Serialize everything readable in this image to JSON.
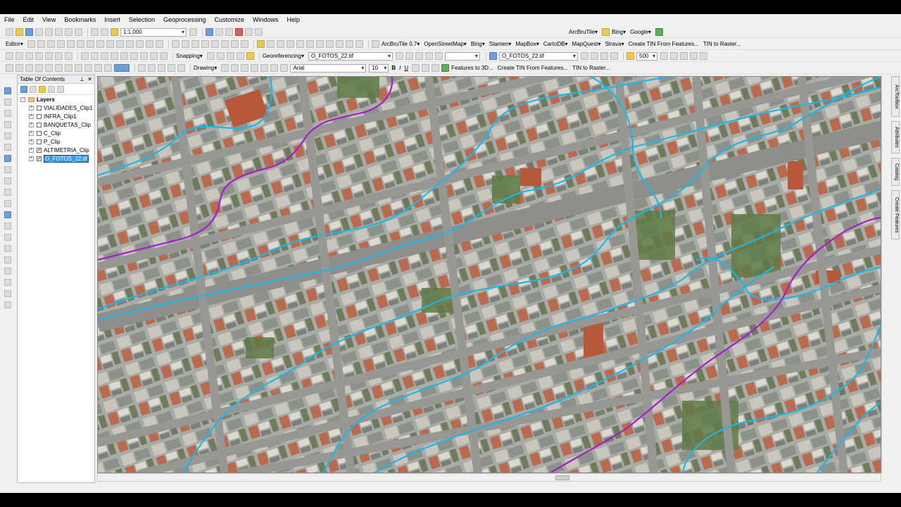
{
  "menu": [
    "File",
    "Edit",
    "View",
    "Bookmarks",
    "Insert",
    "Selection",
    "Geoprocessing",
    "Customize",
    "Windows",
    "Help"
  ],
  "toolbar1": {
    "scale": "1:1,000"
  },
  "toolbar2": {
    "editor": "Editor▾",
    "arcbrutile": "ArcBruTile 0.7▾",
    "openstreetmap": "OpenStreetMap▾",
    "bing": "Bing▾",
    "stamen": "Stamen▾",
    "mapbox": "MapBox▾",
    "cartodb": "CartoDB▾",
    "mapquest": "MapQuest▾",
    "strava": "Strava▾",
    "create_tin": "Create TIN From Features...",
    "tin_to_raster": "TIN to Raster...",
    "arcbrutile2": "ArcBruTile▾",
    "bing2": "Bing▾",
    "google": "Google▾"
  },
  "toolbar3": {
    "snapping": "Snapping▾",
    "georeferencing": "Georeferencing▾",
    "geo_layer": "O_FOTOS_22.tif",
    "layer2": "O_FOTOS_22.tif",
    "transparency": "500"
  },
  "toolbar4": {
    "drawing": "Drawing▾",
    "font": "Arial",
    "size": "10",
    "features3d": "Features to 3D...",
    "create_tin": "Create TIN From Features...",
    "tin_to_raster": "TIN to Raster..."
  },
  "toc": {
    "title": "Table Of Contents",
    "root": "Layers",
    "layers": [
      {
        "name": "VIALIDADES_Clip1",
        "checked": false
      },
      {
        "name": "INFRA_Clip1",
        "checked": false
      },
      {
        "name": "BANQUETAS_Clip",
        "checked": false
      },
      {
        "name": "C_Clip",
        "checked": false
      },
      {
        "name": "P_Clip",
        "checked": false
      },
      {
        "name": "ALTIMETRIA_Clip",
        "checked": true
      },
      {
        "name": "O_FOTOS_22.tif",
        "checked": true,
        "selected": true
      }
    ]
  },
  "right_dock": [
    "ArcToolbox",
    "Attributes",
    "Catalog",
    "Create Features"
  ],
  "colors": {
    "contour_blue": "#1fb6e6",
    "contour_purple": "#a51fc8",
    "road": "#8e8f8c",
    "toc_selected": "#3399ff"
  }
}
